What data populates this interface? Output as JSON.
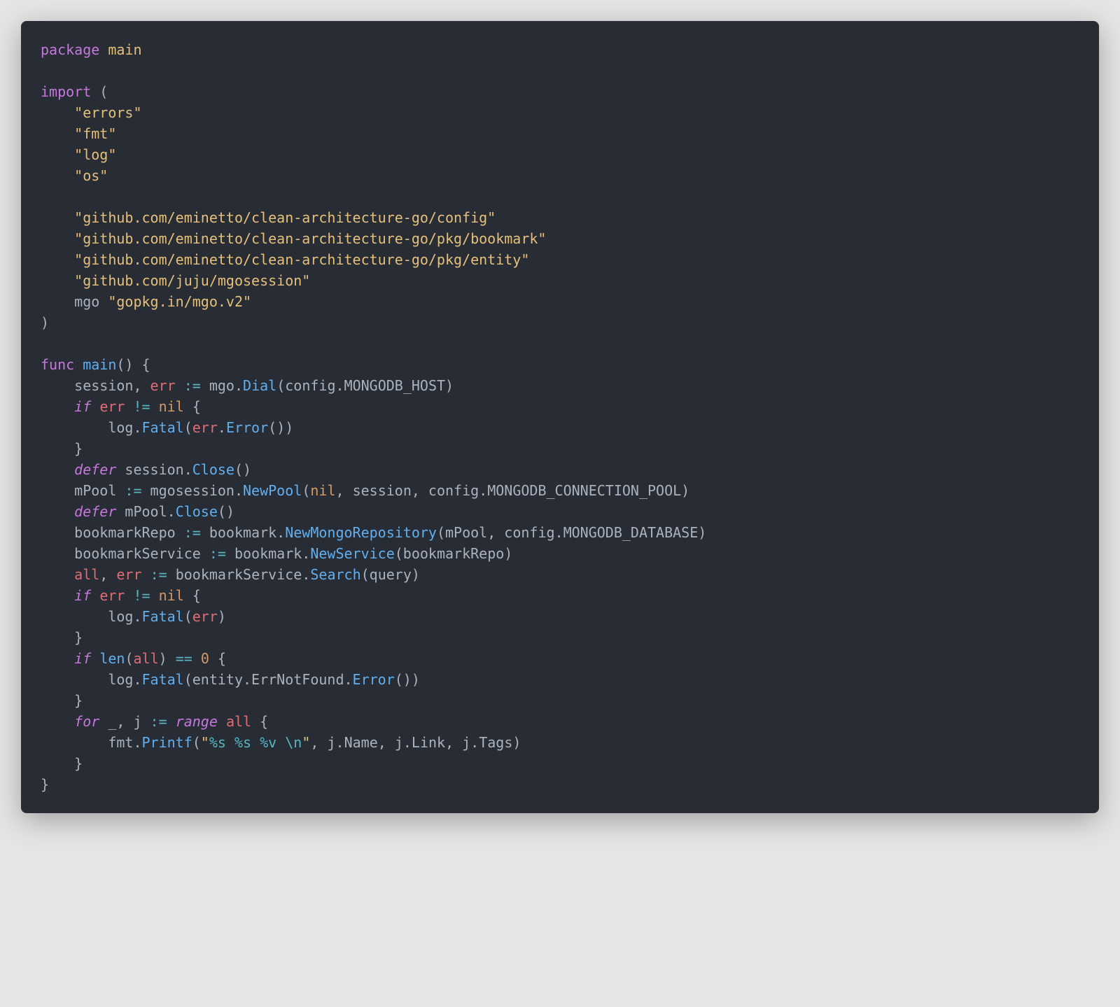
{
  "code": {
    "lines": [
      [
        {
          "c": "kw",
          "t": "package"
        },
        {
          "c": "def",
          "t": " "
        },
        {
          "c": "pkg",
          "t": "main"
        }
      ],
      [],
      [
        {
          "c": "kw",
          "t": "import"
        },
        {
          "c": "def",
          "t": " ("
        }
      ],
      [
        {
          "c": "def",
          "t": "    "
        },
        {
          "c": "str",
          "t": "\"errors\""
        }
      ],
      [
        {
          "c": "def",
          "t": "    "
        },
        {
          "c": "str",
          "t": "\"fmt\""
        }
      ],
      [
        {
          "c": "def",
          "t": "    "
        },
        {
          "c": "str",
          "t": "\"log\""
        }
      ],
      [
        {
          "c": "def",
          "t": "    "
        },
        {
          "c": "str",
          "t": "\"os\""
        }
      ],
      [],
      [
        {
          "c": "def",
          "t": "    "
        },
        {
          "c": "str",
          "t": "\"github.com/eminetto/clean-architecture-go/config\""
        }
      ],
      [
        {
          "c": "def",
          "t": "    "
        },
        {
          "c": "str",
          "t": "\"github.com/eminetto/clean-architecture-go/pkg/bookmark\""
        }
      ],
      [
        {
          "c": "def",
          "t": "    "
        },
        {
          "c": "str",
          "t": "\"github.com/eminetto/clean-architecture-go/pkg/entity\""
        }
      ],
      [
        {
          "c": "def",
          "t": "    "
        },
        {
          "c": "str",
          "t": "\"github.com/juju/mgosession\""
        }
      ],
      [
        {
          "c": "def",
          "t": "    mgo "
        },
        {
          "c": "str",
          "t": "\"gopkg.in/mgo.v2\""
        }
      ],
      [
        {
          "c": "def",
          "t": ")"
        }
      ],
      [],
      [
        {
          "c": "kw",
          "t": "func"
        },
        {
          "c": "def",
          "t": " "
        },
        {
          "c": "fn",
          "t": "main"
        },
        {
          "c": "def",
          "t": "() {"
        }
      ],
      [
        {
          "c": "def",
          "t": "    session, "
        },
        {
          "c": "ident",
          "t": "err"
        },
        {
          "c": "def",
          "t": " "
        },
        {
          "c": "op",
          "t": ":="
        },
        {
          "c": "def",
          "t": " mgo."
        },
        {
          "c": "fn",
          "t": "Dial"
        },
        {
          "c": "def",
          "t": "(config.MONGODB_HOST)"
        }
      ],
      [
        {
          "c": "def",
          "t": "    "
        },
        {
          "c": "kw-i",
          "t": "if"
        },
        {
          "c": "def",
          "t": " "
        },
        {
          "c": "ident",
          "t": "err"
        },
        {
          "c": "def",
          "t": " "
        },
        {
          "c": "op",
          "t": "!="
        },
        {
          "c": "def",
          "t": " "
        },
        {
          "c": "nil",
          "t": "nil"
        },
        {
          "c": "def",
          "t": " {"
        }
      ],
      [
        {
          "c": "def",
          "t": "        log."
        },
        {
          "c": "fn",
          "t": "Fatal"
        },
        {
          "c": "def",
          "t": "("
        },
        {
          "c": "ident",
          "t": "err"
        },
        {
          "c": "def",
          "t": "."
        },
        {
          "c": "fn",
          "t": "Error"
        },
        {
          "c": "def",
          "t": "())"
        }
      ],
      [
        {
          "c": "def",
          "t": "    }"
        }
      ],
      [
        {
          "c": "def",
          "t": "    "
        },
        {
          "c": "kw-i",
          "t": "defer"
        },
        {
          "c": "def",
          "t": " session."
        },
        {
          "c": "fn",
          "t": "Close"
        },
        {
          "c": "def",
          "t": "()"
        }
      ],
      [
        {
          "c": "def",
          "t": "    mPool "
        },
        {
          "c": "op",
          "t": ":="
        },
        {
          "c": "def",
          "t": " mgosession."
        },
        {
          "c": "fn",
          "t": "NewPool"
        },
        {
          "c": "def",
          "t": "("
        },
        {
          "c": "nil",
          "t": "nil"
        },
        {
          "c": "def",
          "t": ", session, config.MONGODB_CONNECTION_POOL)"
        }
      ],
      [
        {
          "c": "def",
          "t": "    "
        },
        {
          "c": "kw-i",
          "t": "defer"
        },
        {
          "c": "def",
          "t": " mPool."
        },
        {
          "c": "fn",
          "t": "Close"
        },
        {
          "c": "def",
          "t": "()"
        }
      ],
      [
        {
          "c": "def",
          "t": "    bookmarkRepo "
        },
        {
          "c": "op",
          "t": ":="
        },
        {
          "c": "def",
          "t": " bookmark."
        },
        {
          "c": "fn",
          "t": "NewMongoRepository"
        },
        {
          "c": "def",
          "t": "(mPool, config.MONGODB_DATABASE)"
        }
      ],
      [
        {
          "c": "def",
          "t": "    bookmarkService "
        },
        {
          "c": "op",
          "t": ":="
        },
        {
          "c": "def",
          "t": " bookmark."
        },
        {
          "c": "fn",
          "t": "NewService"
        },
        {
          "c": "def",
          "t": "(bookmarkRepo)"
        }
      ],
      [
        {
          "c": "def",
          "t": "    "
        },
        {
          "c": "ident",
          "t": "all"
        },
        {
          "c": "def",
          "t": ", "
        },
        {
          "c": "ident",
          "t": "err"
        },
        {
          "c": "def",
          "t": " "
        },
        {
          "c": "op",
          "t": ":="
        },
        {
          "c": "def",
          "t": " bookmarkService."
        },
        {
          "c": "fn",
          "t": "Search"
        },
        {
          "c": "def",
          "t": "(query)"
        }
      ],
      [
        {
          "c": "def",
          "t": "    "
        },
        {
          "c": "kw-i",
          "t": "if"
        },
        {
          "c": "def",
          "t": " "
        },
        {
          "c": "ident",
          "t": "err"
        },
        {
          "c": "def",
          "t": " "
        },
        {
          "c": "op",
          "t": "!="
        },
        {
          "c": "def",
          "t": " "
        },
        {
          "c": "nil",
          "t": "nil"
        },
        {
          "c": "def",
          "t": " {"
        }
      ],
      [
        {
          "c": "def",
          "t": "        log."
        },
        {
          "c": "fn",
          "t": "Fatal"
        },
        {
          "c": "def",
          "t": "("
        },
        {
          "c": "ident",
          "t": "err"
        },
        {
          "c": "def",
          "t": ")"
        }
      ],
      [
        {
          "c": "def",
          "t": "    }"
        }
      ],
      [
        {
          "c": "def",
          "t": "    "
        },
        {
          "c": "kw-i",
          "t": "if"
        },
        {
          "c": "def",
          "t": " "
        },
        {
          "c": "fn",
          "t": "len"
        },
        {
          "c": "def",
          "t": "("
        },
        {
          "c": "ident",
          "t": "all"
        },
        {
          "c": "def",
          "t": ") "
        },
        {
          "c": "op",
          "t": "=="
        },
        {
          "c": "def",
          "t": " "
        },
        {
          "c": "nil",
          "t": "0"
        },
        {
          "c": "def",
          "t": " {"
        }
      ],
      [
        {
          "c": "def",
          "t": "        log."
        },
        {
          "c": "fn",
          "t": "Fatal"
        },
        {
          "c": "def",
          "t": "(entity.ErrNotFound."
        },
        {
          "c": "fn",
          "t": "Error"
        },
        {
          "c": "def",
          "t": "())"
        }
      ],
      [
        {
          "c": "def",
          "t": "    }"
        }
      ],
      [
        {
          "c": "def",
          "t": "    "
        },
        {
          "c": "kw-i",
          "t": "for"
        },
        {
          "c": "def",
          "t": " _, j "
        },
        {
          "c": "op",
          "t": ":="
        },
        {
          "c": "def",
          "t": " "
        },
        {
          "c": "kw-i",
          "t": "range"
        },
        {
          "c": "def",
          "t": " "
        },
        {
          "c": "ident",
          "t": "all"
        },
        {
          "c": "def",
          "t": " {"
        }
      ],
      [
        {
          "c": "def",
          "t": "        fmt."
        },
        {
          "c": "fn",
          "t": "Printf"
        },
        {
          "c": "def",
          "t": "("
        },
        {
          "c": "str",
          "t": "\""
        },
        {
          "c": "str-fmt",
          "t": "%s"
        },
        {
          "c": "str",
          "t": " "
        },
        {
          "c": "str-fmt",
          "t": "%s"
        },
        {
          "c": "str",
          "t": " "
        },
        {
          "c": "str-fmt",
          "t": "%v"
        },
        {
          "c": "str",
          "t": " "
        },
        {
          "c": "str-fmt",
          "t": "\\n"
        },
        {
          "c": "str",
          "t": "\""
        },
        {
          "c": "def",
          "t": ", j.Name, j.Link, j.Tags)"
        }
      ],
      [
        {
          "c": "def",
          "t": "    }"
        }
      ],
      [
        {
          "c": "def",
          "t": "}"
        }
      ]
    ]
  }
}
